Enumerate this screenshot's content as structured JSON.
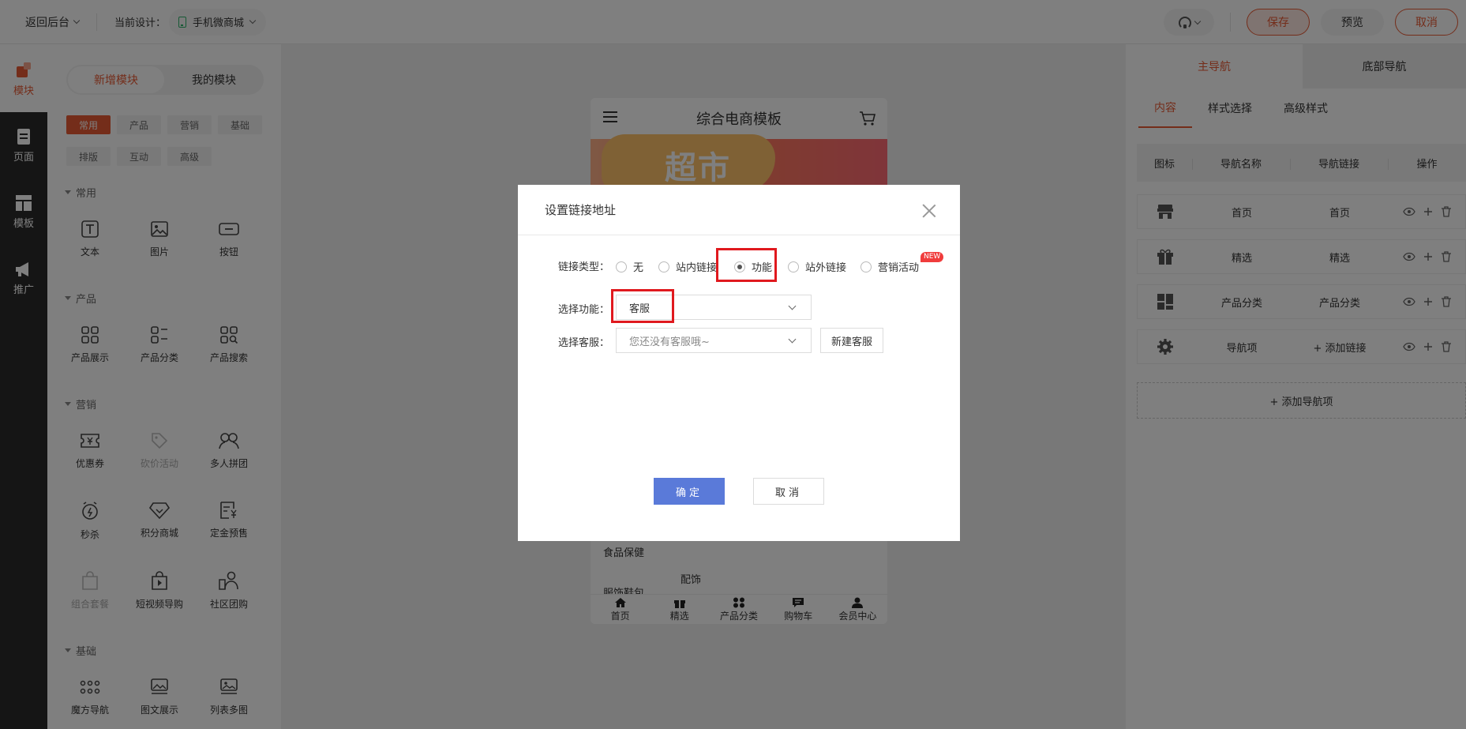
{
  "topbar": {
    "back_label": "返回后台",
    "design_label": "当前设计：",
    "design_value": "手机微商城",
    "save": "保存",
    "preview": "预览",
    "cancel": "取消"
  },
  "sidebar": {
    "items": [
      {
        "label": "模块",
        "icon": "module-icon"
      },
      {
        "label": "页面",
        "icon": "page-icon"
      },
      {
        "label": "模板",
        "icon": "template-icon"
      },
      {
        "label": "推广",
        "icon": "megaphone-icon"
      }
    ]
  },
  "components": {
    "tabs": [
      "新增模块",
      "我的模块"
    ],
    "chips": [
      "常用",
      "产品",
      "营销",
      "基础",
      "排版",
      "互动",
      "高级"
    ],
    "categories": [
      {
        "title": "常用",
        "items": [
          "文本",
          "图片",
          "按钮"
        ]
      },
      {
        "title": "产品",
        "items": [
          "产品展示",
          "产品分类",
          "产品搜索"
        ]
      },
      {
        "title": "营销",
        "items": [
          "优惠券",
          "砍价活动",
          "多人拼团",
          "秒杀",
          "积分商城",
          "定金预售",
          "组合套餐",
          "短视频导购",
          "社区团购"
        ]
      },
      {
        "title": "基础",
        "items": [
          "魔方导航",
          "图文展示",
          "列表多图"
        ]
      }
    ]
  },
  "phone": {
    "title": "综合电商模板",
    "banner_text": "超市",
    "side_categories": [
      "食品保健",
      "服饰鞋包"
    ],
    "right_category": "配饰",
    "tabbar": [
      "首页",
      "精选",
      "产品分类",
      "购物车",
      "会员中心"
    ]
  },
  "right_panel": {
    "tabs": [
      "主导航",
      "底部导航"
    ],
    "sub_tabs": [
      "内容",
      "样式选择",
      "高级样式"
    ],
    "table_head": [
      "图标",
      "导航名称",
      "导航链接",
      "操作"
    ],
    "rows": [
      {
        "name": "首页",
        "link": "首页",
        "icon": "store-icon"
      },
      {
        "name": "精选",
        "link": "精选",
        "icon": "gift-icon"
      },
      {
        "name": "产品分类",
        "link": "产品分类",
        "icon": "grid-icon"
      },
      {
        "name": "导航项",
        "link": "+ 添加链接",
        "icon": "gear-icon"
      }
    ],
    "add_nav": "+ 添加导航项"
  },
  "modal": {
    "title": "设置链接地址",
    "link_type_label": "链接类型：",
    "link_types": [
      "无",
      "站内链接",
      "功能",
      "站外链接",
      "营销活动"
    ],
    "selected_link_type": "功能",
    "new_badge": "NEW",
    "function_label": "选择功能：",
    "function_value": "客服",
    "service_label": "选择客服：",
    "service_placeholder": "您还没有客服哦~",
    "new_service": "新建客服",
    "ok": "确定",
    "cancel": "取消"
  },
  "colors": {
    "accent": "#e85a35",
    "primary_button": "#5a7ad9",
    "highlight": "#e0191e"
  }
}
